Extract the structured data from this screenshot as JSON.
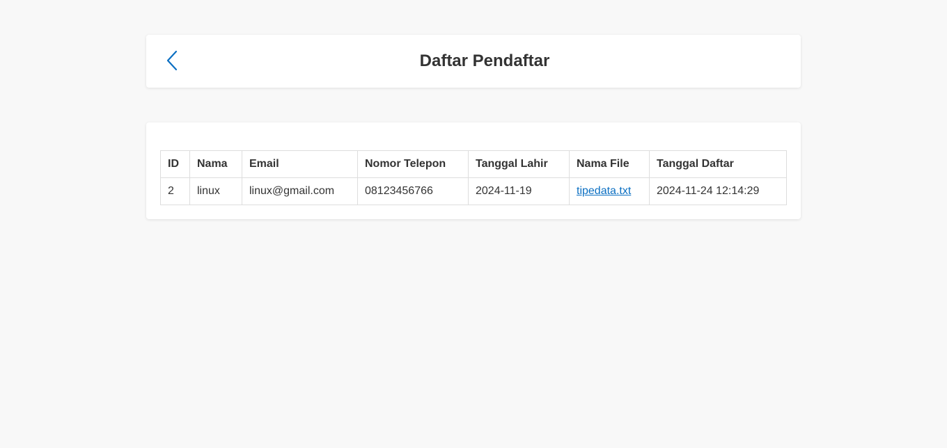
{
  "header": {
    "title": "Daftar Pendaftar",
    "back_icon": "chevron-left-icon",
    "accent_color": "#0b6fc2"
  },
  "table": {
    "columns": [
      "ID",
      "Nama",
      "Email",
      "Nomor Telepon",
      "Tanggal Lahir",
      "Nama File",
      "Tanggal Daftar"
    ],
    "rows": [
      {
        "id": "2",
        "nama": "linux",
        "email": "linux@gmail.com",
        "telepon": "08123456766",
        "tanggal_lahir": "2024-11-19",
        "nama_file": "tipedata.txt",
        "tanggal_daftar": "2024-11-24 12:14:29"
      }
    ]
  }
}
